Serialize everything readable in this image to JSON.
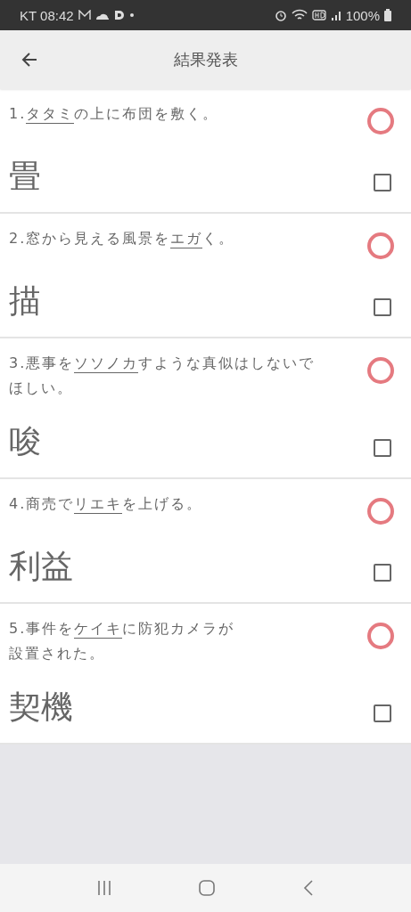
{
  "status_bar": {
    "carrier_time": "KT 08:42",
    "battery": "100%"
  },
  "header": {
    "title": "結果発表"
  },
  "items": [
    {
      "number": "1.",
      "parts": [
        {
          "text": "タタミ",
          "underlined": true
        },
        {
          "text": "の上に布団を敷く。",
          "underlined": false
        }
      ],
      "answer": "畳",
      "correct": true,
      "checked": false
    },
    {
      "number": "2.",
      "parts": [
        {
          "text": "窓から見える風景を",
          "underlined": false
        },
        {
          "text": "エガ",
          "underlined": true
        },
        {
          "text": "く。",
          "underlined": false
        }
      ],
      "answer": "描",
      "correct": true,
      "checked": false
    },
    {
      "number": "3.",
      "parts": [
        {
          "text": "悪事を",
          "underlined": false
        },
        {
          "text": "ソソノカ",
          "underlined": true
        },
        {
          "text": "すような真似はしないでほしい。",
          "underlined": false
        }
      ],
      "answer": "唆",
      "correct": true,
      "checked": false
    },
    {
      "number": "4.",
      "parts": [
        {
          "text": "商売で",
          "underlined": false
        },
        {
          "text": "リエキ",
          "underlined": true
        },
        {
          "text": "を上げる。",
          "underlined": false
        }
      ],
      "answer": "利益",
      "correct": true,
      "checked": false
    },
    {
      "number": "5.",
      "parts": [
        {
          "text": "事件を",
          "underlined": false
        },
        {
          "text": "ケイキ",
          "underlined": true
        },
        {
          "text": "に防犯カメラが",
          "underlined": false,
          "line_end": true
        },
        {
          "text": "設置された。",
          "underlined": false
        }
      ],
      "answer": "契機",
      "correct": true,
      "checked": false
    }
  ]
}
